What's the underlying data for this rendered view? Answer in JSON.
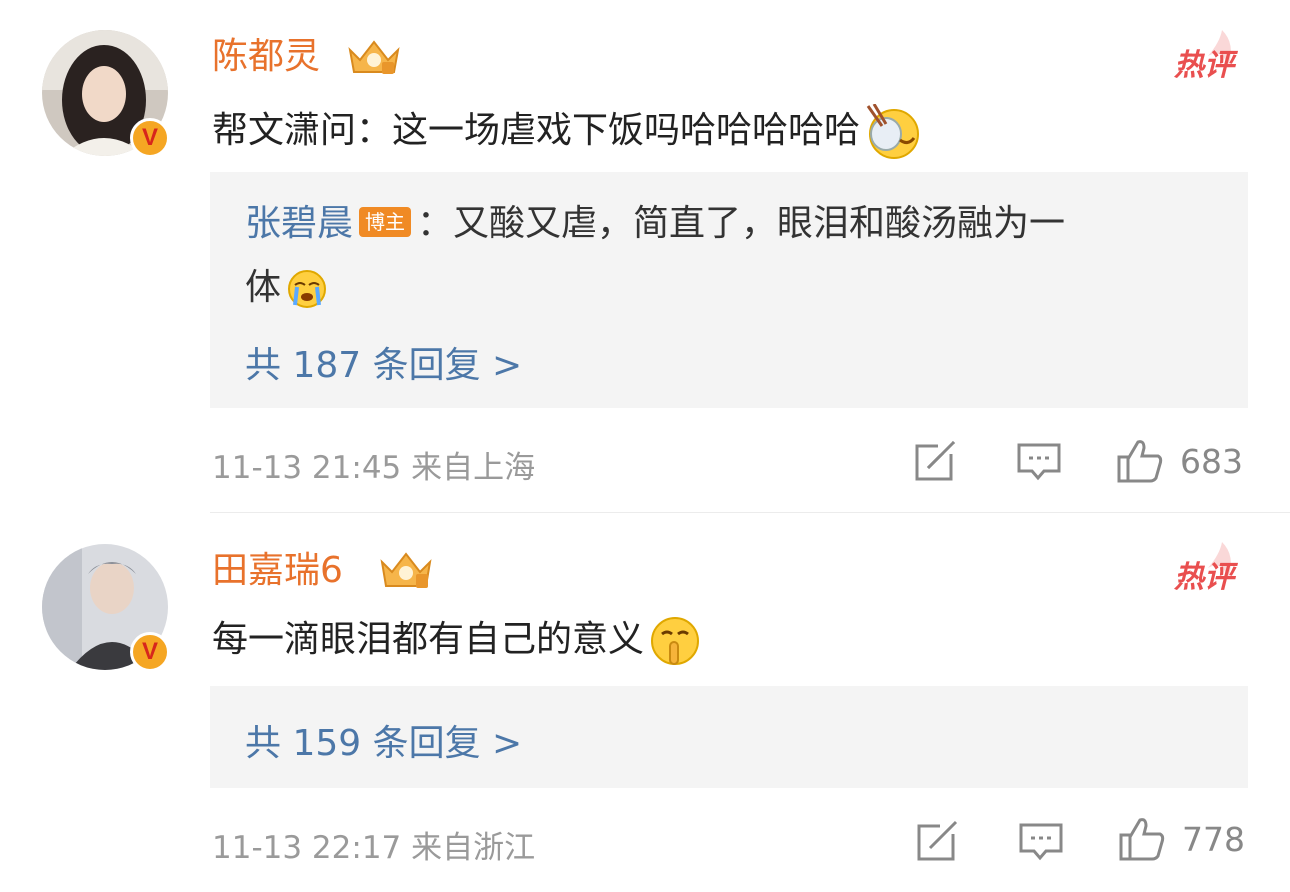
{
  "comments": [
    {
      "username": "陈都灵",
      "hot_label": "热评",
      "text": "帮文潇问：这一场虐戏下饭吗哈哈哈哈哈",
      "reply": {
        "user": "张碧晨",
        "tag": "博主",
        "text_line1": "：又酸又虐，简直了，眼泪和酸汤融为一",
        "text_line2": "体"
      },
      "reply_count": "共 187 条回复 >",
      "time": "11-13 21:45",
      "location": "来自上海",
      "likes": "683"
    },
    {
      "username": "田嘉瑞6",
      "hot_label": "热评",
      "text": "每一滴眼泪都有自己的意义",
      "reply_count": "共 159 条回复 >",
      "time": "11-13 22:17",
      "location": "来自浙江",
      "likes": "778"
    }
  ],
  "icons": {
    "verified": "verified-v-icon",
    "crown": "member-crown-icon",
    "share": "share-icon",
    "comment": "comment-icon",
    "like": "thumbs-up-icon"
  },
  "colors": {
    "username": "#e8722c",
    "link": "#4c77a8",
    "hot": "#e94f4f",
    "meta": "#9a9a9a"
  }
}
